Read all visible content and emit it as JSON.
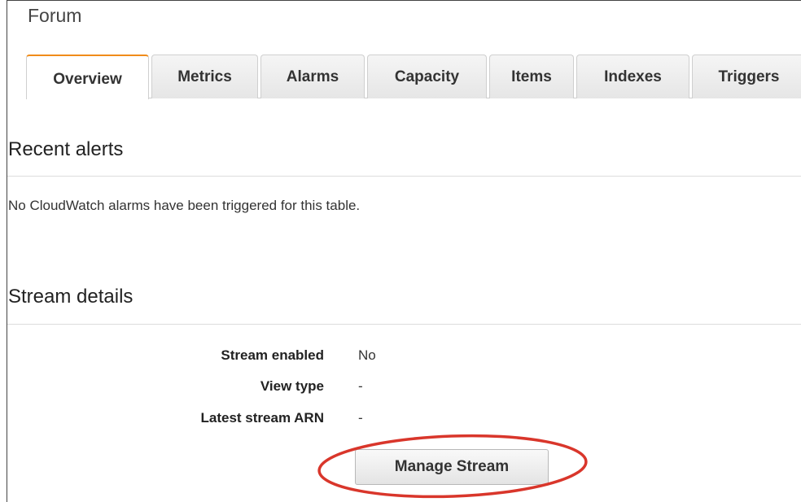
{
  "table": {
    "title": "Forum"
  },
  "tabs": [
    {
      "label": "Overview",
      "active": true
    },
    {
      "label": "Metrics",
      "active": false
    },
    {
      "label": "Alarms",
      "active": false
    },
    {
      "label": "Capacity",
      "active": false
    },
    {
      "label": "Items",
      "active": false
    },
    {
      "label": "Indexes",
      "active": false
    },
    {
      "label": "Triggers",
      "active": false
    }
  ],
  "recent_alerts": {
    "heading": "Recent alerts",
    "message": "No CloudWatch alarms have been triggered for this table."
  },
  "stream_details": {
    "heading": "Stream details",
    "rows": [
      {
        "label": "Stream enabled",
        "value": "No"
      },
      {
        "label": "View type",
        "value": "-"
      },
      {
        "label": "Latest stream ARN",
        "value": "-"
      }
    ],
    "manage_button_label": "Manage Stream"
  },
  "colors": {
    "active_tab_accent": "#f08c1a",
    "highlight_ring": "#d9362b"
  }
}
